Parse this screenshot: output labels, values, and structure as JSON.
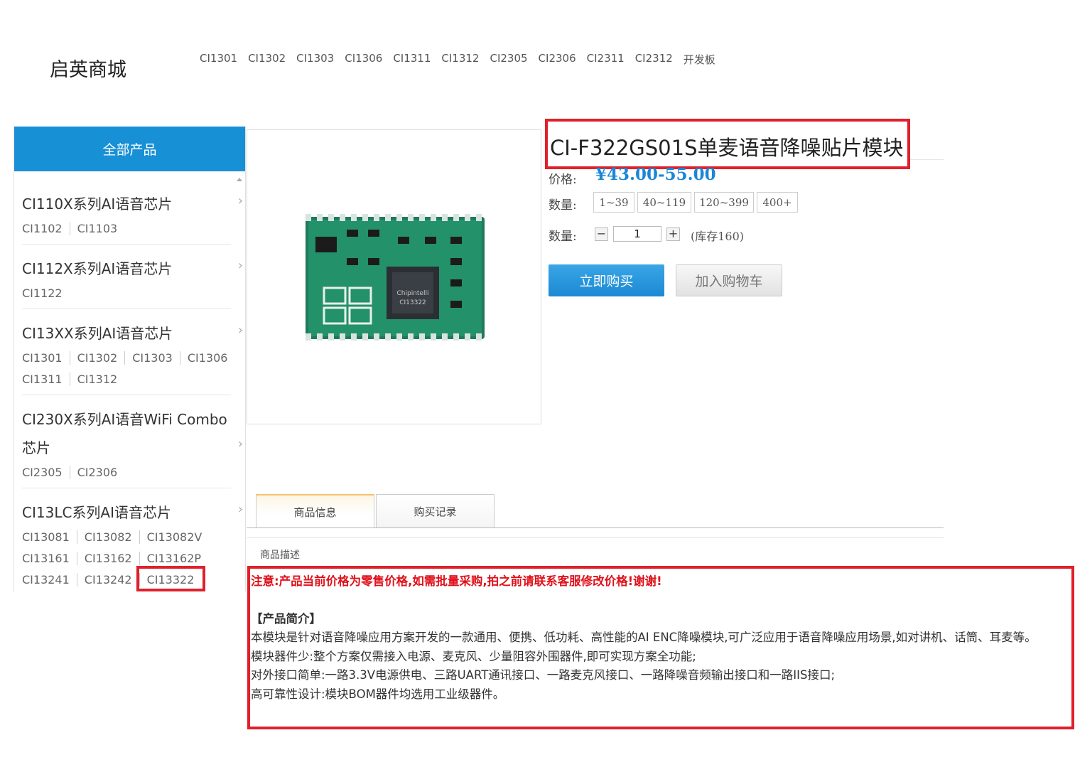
{
  "site": {
    "logo": "启英商城"
  },
  "topnav": [
    "CI1301",
    "CI1302",
    "CI1303",
    "CI1306",
    "CI1311",
    "CI1312",
    "CI2305",
    "CI2306",
    "CI2311",
    "CI2312",
    "开发板"
  ],
  "sidebar": {
    "header": "全部产品",
    "categories": [
      {
        "title": "CI110X系列AI语音芯片",
        "links": [
          "CI1102",
          "CI1103"
        ]
      },
      {
        "title": "CI112X系列AI语音芯片",
        "links": [
          "CI1122"
        ]
      },
      {
        "title": "CI13XX系列AI语音芯片",
        "links": [
          "CI1301",
          "CI1302",
          "CI1303",
          "CI1306",
          "CI1311",
          "CI1312"
        ]
      },
      {
        "title_line1": "CI230X系列AI语音WiFi Combo",
        "title_line2": "芯片",
        "links": [
          "CI2305",
          "CI2306"
        ]
      },
      {
        "title": "CI13LC系列AI语音芯片",
        "links": [
          "CI13081",
          "CI13082",
          "CI13082V",
          "CI13161",
          "CI13162",
          "CI13162P",
          "CI13241",
          "CI13242",
          "CI13322"
        ]
      }
    ]
  },
  "product": {
    "title": "CI-F322GS01S单麦语音降噪贴片模块",
    "price_label": "价格:",
    "price": "¥43.00-55.00",
    "tier_label": "数量:",
    "tiers": [
      "1~39",
      "40~119",
      "120~399",
      "400+"
    ],
    "qty_label": "数量:",
    "qty_value": "1",
    "minus": "−",
    "plus": "+",
    "stock": "(库存160)",
    "buy_label": "立即购买",
    "cart_label": "加入购物车",
    "image_alt": "模块图片"
  },
  "tabs": [
    "商品信息",
    "购买记录"
  ],
  "description": {
    "label": "商品描述",
    "notice": "注意:产品当前价格为零售价格,如需批量采购,拍之前请联系客服修改价格!谢谢!",
    "heading": "【产品简介】",
    "p1": "本模块是针对语音降噪应用方案开发的一款通用、便携、低功耗、高性能的AI ENC降噪模块,可广泛应用于语音降噪应用场景,如对讲机、话筒、耳麦等。",
    "p2": "模块器件少:整个方案仅需接入电源、麦克风、少量阻容外围器件,即可实现方案全功能;",
    "p3": "对外接口简单:一路3.3V电源供电、三路UART通讯接口、一路麦克风接口、一路降噪音频输出接口和一路IIS接口;",
    "p4": "高可靠性设计:模块BOM器件均选用工业级器件。"
  },
  "colors": {
    "accent": "#1890d6",
    "highlight": "#e0202a",
    "notice": "#e0101a"
  }
}
